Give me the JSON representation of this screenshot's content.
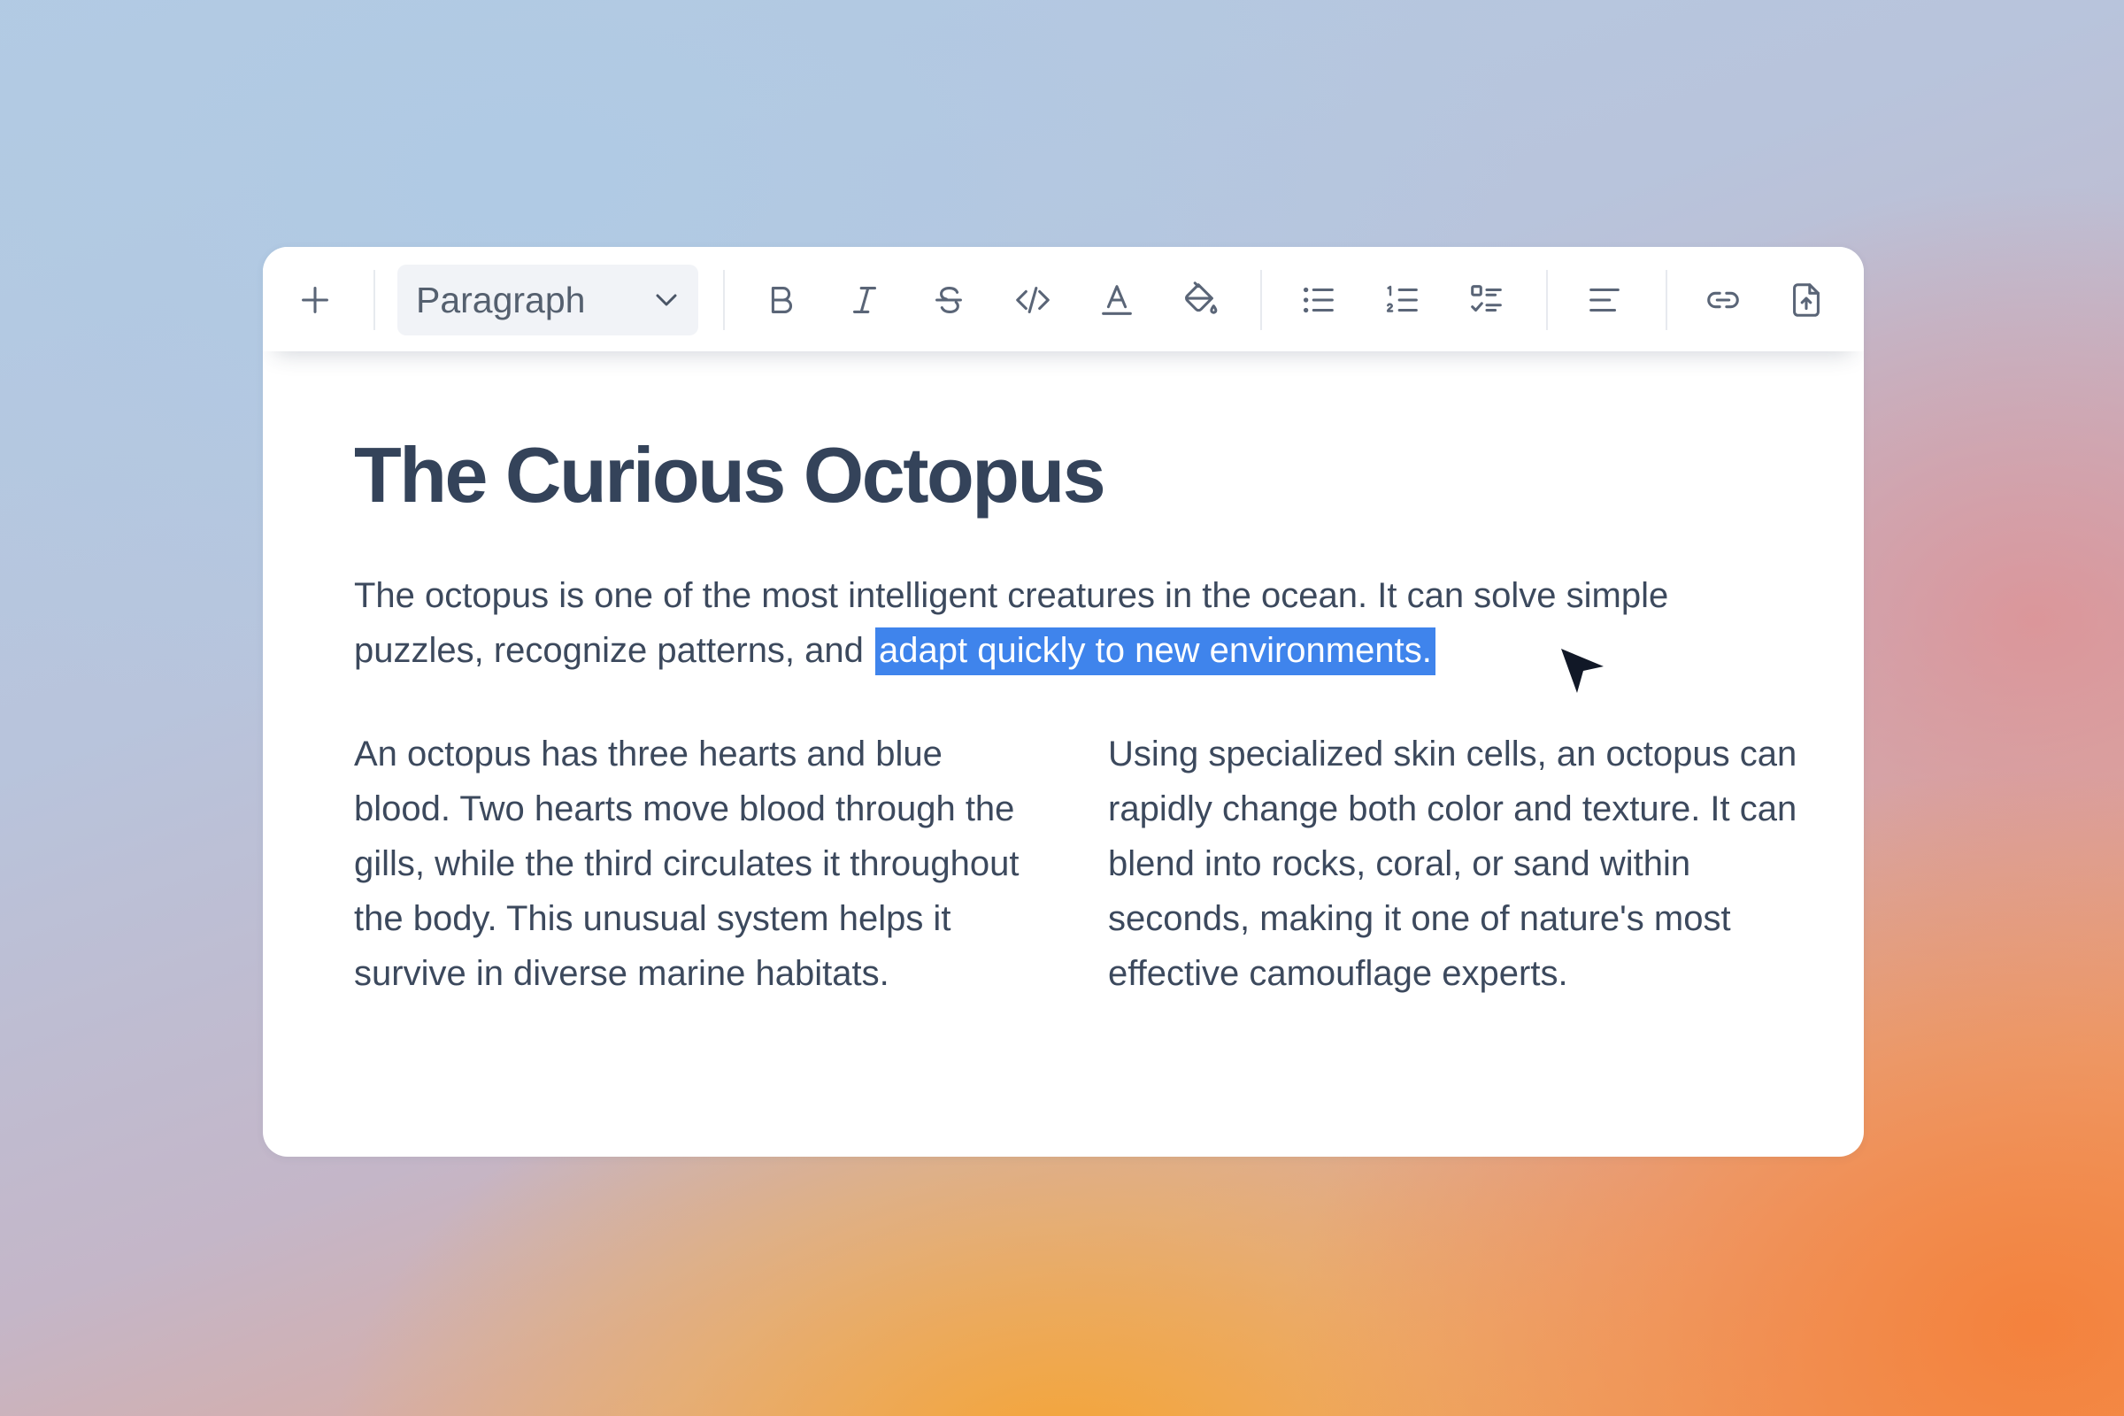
{
  "toolbar": {
    "add_icon": "plus-icon",
    "block_type": "Paragraph",
    "tools": [
      {
        "name": "bold",
        "icon": "bold-icon"
      },
      {
        "name": "italic",
        "icon": "italic-icon"
      },
      {
        "name": "strikethrough",
        "icon": "strikethrough-icon"
      },
      {
        "name": "code",
        "icon": "code-icon"
      },
      {
        "name": "text-color",
        "icon": "text-color-icon"
      },
      {
        "name": "highlight",
        "icon": "paint-bucket-icon"
      },
      {
        "name": "bullet-list",
        "icon": "bullet-list-icon"
      },
      {
        "name": "ordered-list",
        "icon": "ordered-list-icon"
      },
      {
        "name": "task-list",
        "icon": "checklist-icon"
      },
      {
        "name": "align",
        "icon": "align-left-icon"
      },
      {
        "name": "link",
        "icon": "link-icon"
      },
      {
        "name": "upload",
        "icon": "file-upload-icon"
      }
    ]
  },
  "document": {
    "title": "The Curious Octopus",
    "intro_plain": "The octopus is one of the most intelligent creatures in the ocean. It can solve simple puzzles, recognize patterns, and",
    "intro_selected": "adapt quickly to new environments.",
    "column_left": "An octopus has three hearts and blue blood. Two hearts move blood through the gills, while the third circulates it throughout the body. This unusual system helps it survive in diverse marine habitats.",
    "column_right": "Using specialized skin cells, an octopus can rapidly change both color and texture. It can blend into rocks, coral, or sand within seconds, making it one of nature's most effective camouflage experts."
  },
  "colors": {
    "selection": "#3f84ec",
    "title_text": "#34435a",
    "body_text": "#3c495d",
    "icon": "#5a6577"
  }
}
